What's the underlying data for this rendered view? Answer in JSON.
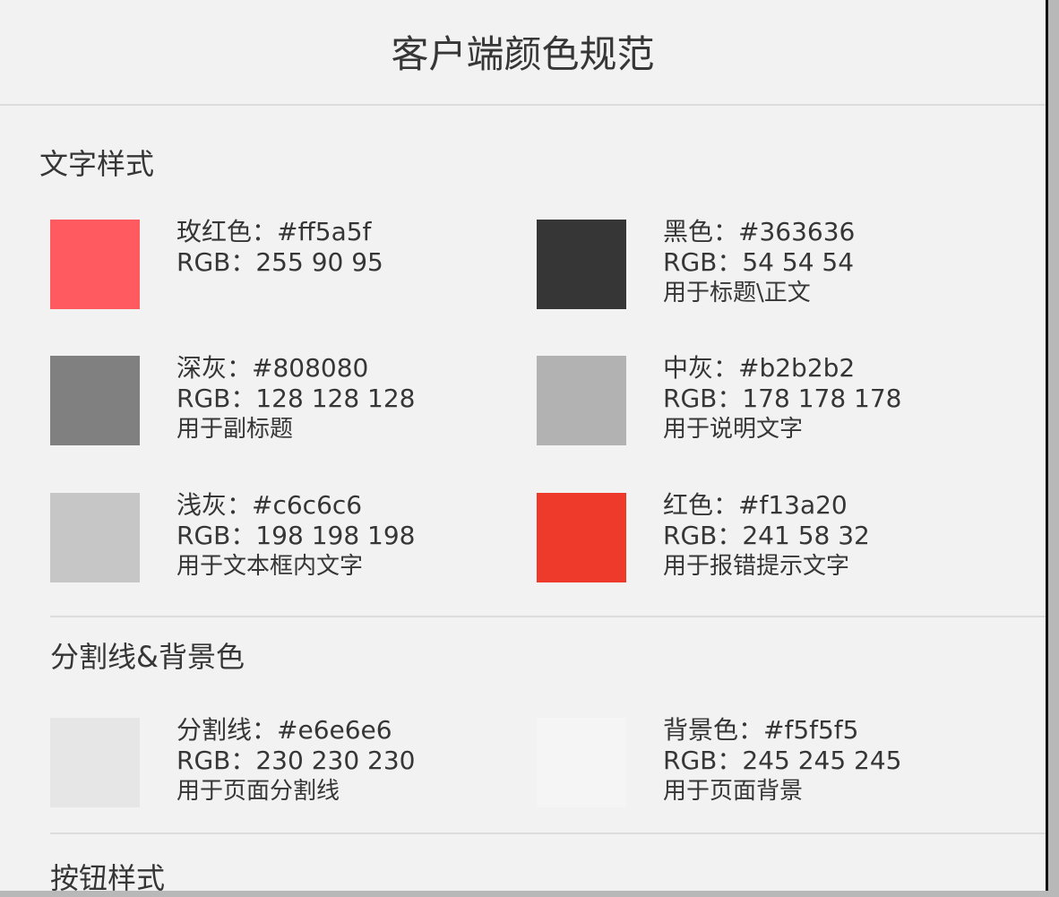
{
  "title": "客户端颜色规范",
  "sections": [
    "文字样式",
    "分割线&背景色",
    "按钮样式"
  ],
  "text_colors": [
    {
      "name": "玫红色：#ff5a5f",
      "rgb": "RGB：255 90 95",
      "use": "",
      "color": "#ff5a5f"
    },
    {
      "name": "黑色：#363636",
      "rgb": "RGB：54 54 54",
      "use": "用于标题\\正文",
      "color": "#363636"
    },
    {
      "name": "深灰：#808080",
      "rgb": "RGB：128 128 128",
      "use": "用于副标题",
      "color": "#808080"
    },
    {
      "name": "中灰：#b2b2b2",
      "rgb": "RGB：178 178 178",
      "use": "用于说明文字",
      "color": "#b2b2b2"
    },
    {
      "name": "浅灰：#c6c6c6",
      "rgb": "RGB：198 198 198",
      "use": "用于文本框内文字",
      "color": "#c6c6c6"
    },
    {
      "name": "红色：#f13a20",
      "rgb": "RGB：241 58 32",
      "use": "用于报错提示文字",
      "color": "#ee3a2a"
    }
  ],
  "bg_colors": [
    {
      "name": "分割线：#e6e6e6",
      "rgb": "RGB：230 230 230",
      "use": "用于页面分割线",
      "color": "#e6e6e6"
    },
    {
      "name": "背景色：#f5f5f5",
      "rgb": "RGB：245 245 245",
      "use": "用于页面背景",
      "color": "#f5f5f5"
    }
  ]
}
